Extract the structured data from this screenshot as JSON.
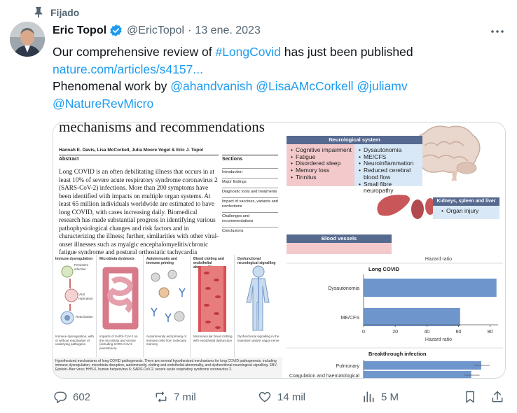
{
  "pinned": {
    "label": "Fijado"
  },
  "tweet": {
    "author_name": "Eric Topol",
    "handle": "@EricTopol",
    "separator": "·",
    "date": "13 ene. 2023",
    "line1_pre": "Our comprehensive review of ",
    "line1_hashtag": "#LongCovid",
    "line1_post": " has just been published",
    "link": "nature.com/articles/s4157...",
    "line3_pre": "Phenomenal work by ",
    "mention1": "@ahandvanish",
    "mention2": "@LisaAMcCorkell",
    "mention3": "@juliamv",
    "mention4": "@NatureRevMicro"
  },
  "paper": {
    "title": "mechanisms and recommendations",
    "authors": "Hannah E. Davis, Lisa McCorkell, Julia Moore Vogel & Eric J. Topol",
    "abstract_heading": "Abstract",
    "abstract_text": "Long COVID is an often debilitating illness that occurs in at least 10% of severe acute respiratory syndrome coronavirus 2 (SARS-CoV-2) infections. More than 200 symptoms have been identified with impacts on multiple organ systems. At least 65 million individuals worldwide are estimated to have long COVID, with cases increasing daily. Biomedical research has made substantial progress in identifying various pathophysiological changes and risk factors and in characterizing the illness; further, similarities with other viral-onset illnesses such as myalgic encephalomyelitis/chronic fatigue syndrome and postural orthostatic tachycardia syndrome have laid the groundwork for research in the field. In this Review, we explore the current literature and highlight key findings, the overlap with other conditions, the",
    "sections_heading": "Sections",
    "sections": [
      "Introduction",
      "Major findings",
      "Diagnostic tools and treatments",
      "Impact of vaccines, variants and reinfections",
      "Challenges and recommendations",
      "Conclusions"
    ]
  },
  "symptoms": {
    "neuro_title": "Neurological system",
    "neuro_left": [
      "Cognitive impairment",
      "Fatigue",
      "Disordered sleep",
      "Memory loss",
      "Tinnitus"
    ],
    "neuro_right": [
      "Dysautonomia",
      "ME/CFS",
      "Neuroinflammation",
      "Reduced cerebral blood flow",
      "Small fibre neuropathy"
    ],
    "kidney_title": "Kidneys, spleen and liver",
    "kidney_items": [
      "Organ injury"
    ],
    "blood_title": "Blood vessels"
  },
  "mechanisms": {
    "columns": [
      {
        "title": "Immune dysregulation",
        "caption": "Immune dysregulation, with or without reactivation of underlying pathogens"
      },
      {
        "title": "Microbiota dysbiosis",
        "caption": "Impacts of SARS-CoV-2 on the microbiota and virome (including SARS-CoV-2 persistence)"
      },
      {
        "title": "Autoimmunity and immune priming",
        "caption": "Autoimmunity and priming of immune cells from molecular memory"
      },
      {
        "title": "Blood clotting and endothelial abnormalities",
        "caption": "Microvascular blood clotting with endothelial dysfunction"
      },
      {
        "title": "Dysfunctional neurological signalling",
        "caption": "Dysfunctional signalling in the brainstem and/or vagus nerve"
      }
    ],
    "labels": [
      "Persistent infection",
      "Viral replication",
      "Reactivation"
    ],
    "figure_caption": "Hypothesized mechanisms of long COVID pathogenesis. There are several hypothesized mechanisms for long COVID pathogenesis, including immune dysregulation, microbiota disruption, autoimmunity, clotting and endothelial abnormality, and dysfunctional neurological signalling. EBV, Epstein–Barr virus; HHV-6, human herpesvirus 6; SARS-CoV-2, severe acute respiratory syndrome coronavirus 2."
  },
  "chart_data": [
    {
      "type": "bar",
      "title": "Long COVID",
      "xlabel": "Hazard ratio",
      "orientation": "horizontal",
      "categories": [
        "Dysautonomia",
        "ME/CFS"
      ],
      "values": [
        84,
        61
      ],
      "xlim": [
        0,
        85
      ],
      "xticks": [
        "0",
        "20",
        "40",
        "60",
        "80"
      ],
      "color": "#6f96cc"
    },
    {
      "type": "bar",
      "title": "Breakthrough infection",
      "orientation": "horizontal",
      "categories": [
        "Pulmonary",
        "Coagulation and haematological"
      ],
      "values": [
        1.75,
        1.6
      ],
      "color": "#6f96cc"
    }
  ],
  "actions": {
    "replies": "602",
    "reposts": "7 mil",
    "likes": "14 mil",
    "views": "5 M"
  }
}
